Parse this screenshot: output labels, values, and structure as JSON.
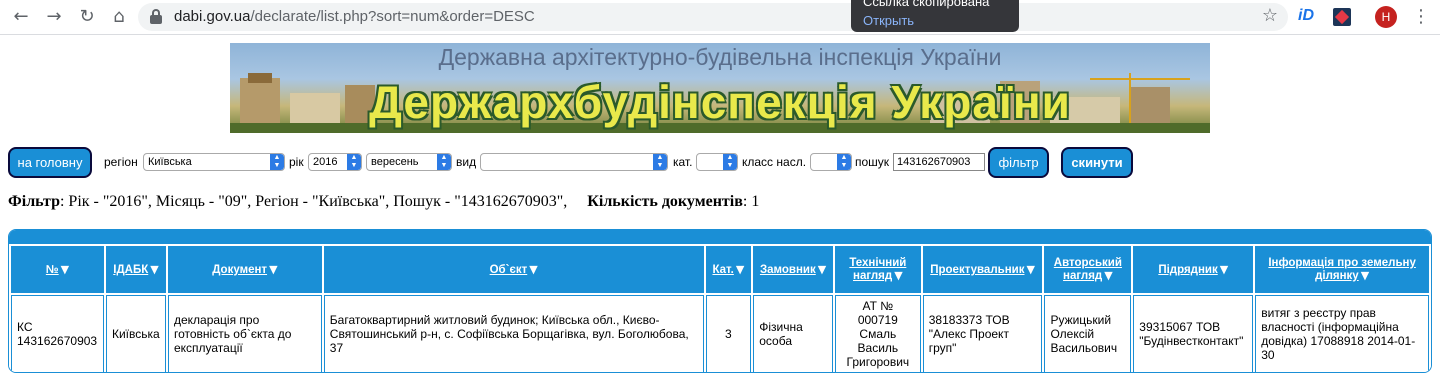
{
  "browser": {
    "url_host": "dabi.gov.ua",
    "url_rest": "/declarate/list.php?sort=num&order=DESC",
    "toast_title": "Ссылка скопирована",
    "toast_action": "Открыть",
    "profile_initial": "Н",
    "ext_label": "iD"
  },
  "banner": {
    "subtitle": "Державна архітектурно-будівельна інспекція України",
    "title": "Держархбудінспекція України"
  },
  "filters": {
    "home_button": "на головну",
    "region_label": "регіон",
    "region_value": "Київська",
    "year_label": "рік",
    "year_value": "2016",
    "month_value": "вересень",
    "type_label": "вид",
    "type_value": "",
    "cat_label": "кат.",
    "cat_value": "",
    "class_label": "класс насл.",
    "class_value": "",
    "search_label": "пошук",
    "search_value": "143162670903",
    "filter_button": "фільтр",
    "reset_button": "скинути"
  },
  "summary": {
    "filter_label": "Фільтр",
    "filter_text": ": Рік - \"2016\", Місяць - \"09\", Регіон - \"Київська\", Пошук - \"143162670903\",",
    "count_label": "Кількість документів",
    "count_text": ": 1"
  },
  "table": {
    "headers": [
      "№",
      "ІДАБК",
      "Документ",
      "Об`єкт",
      "Кат.",
      "Замовник",
      "Технічний нагляд",
      "Проектувальник",
      "Авторський нагляд",
      "Підрядник",
      "Інформація про земельну ділянку"
    ],
    "rows": [
      [
        "КС 143162670903",
        "Київська",
        "декларація про готовність об`єкта до експлуатації",
        "Багатоквартирний житловий будинок; Київська обл., Києво-Святошинський р-н, с. Софіївська Борщагівка, вул. Боголюбова, 37",
        "3",
        "Фізична особа",
        "АТ № 000719 Смаль Василь Григорович",
        "38183373 ТОВ \"Алекс Проект груп\"",
        "Ружицький Олексій Васильович",
        "39315067 ТОВ \"Будінвестконтакт\"",
        "витяг з реєстру прав власності (інформаційна довідка) 17088918 2014-01-30"
      ]
    ]
  }
}
